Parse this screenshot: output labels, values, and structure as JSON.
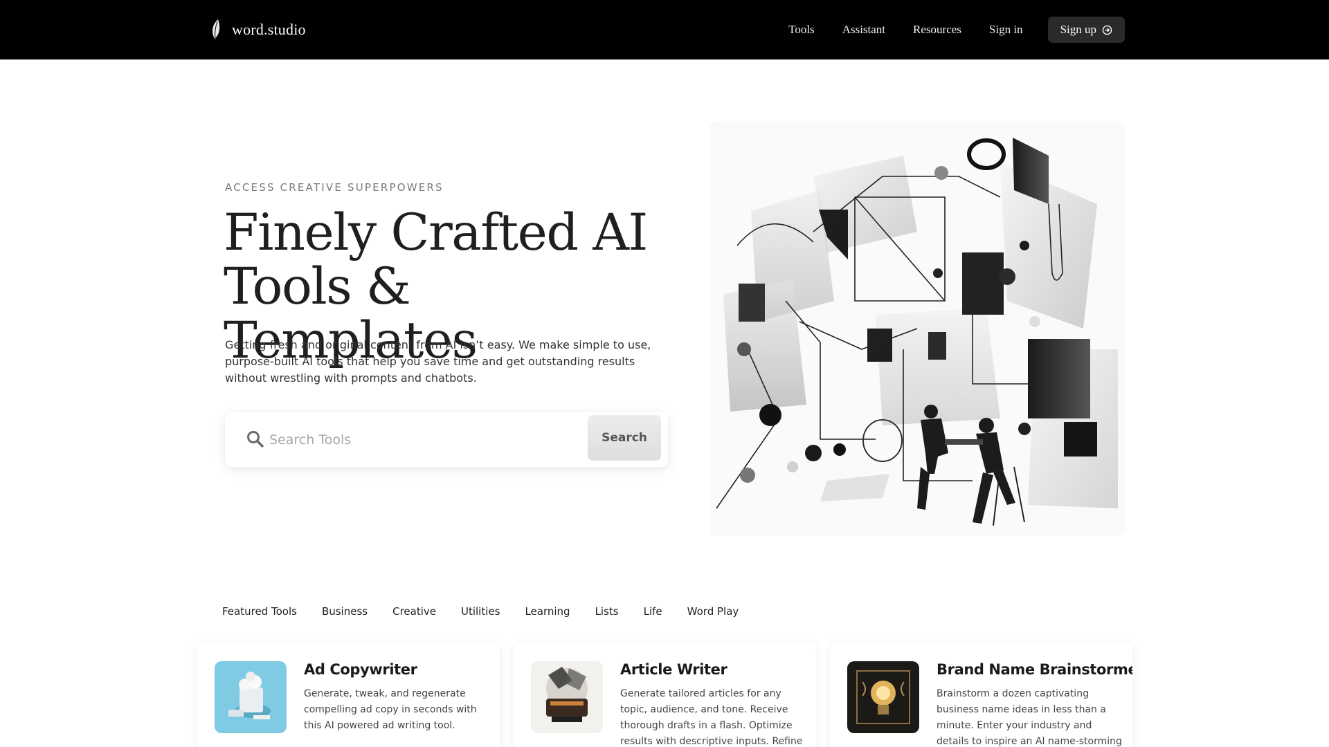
{
  "header": {
    "brand": "word.studio",
    "nav": [
      "Tools",
      "Assistant",
      "Resources",
      "Sign in"
    ],
    "signup_label": "Sign up"
  },
  "hero": {
    "eyebrow": "ACCESS CREATIVE SUPERPOWERS",
    "headline": "Finely Crafted AI Tools & Templates",
    "description": "Getting fresh and original content from AI isn’t easy. We make  simple to use, purpose-built AI tools that help you save time and get outstanding results without wrestling with prompts and chatbots.",
    "search_placeholder": "Search Tools",
    "search_button": "Search"
  },
  "tabs": [
    "Featured Tools",
    "Business",
    "Creative",
    "Utilities",
    "Learning",
    "Lists",
    "Life",
    "Word Play"
  ],
  "cards": [
    {
      "title": "Ad Copywriter",
      "description": "Generate, tweak, and regenerate compelling ad copy in seconds with this AI powered ad writing tool.",
      "thumb_color": "#7fcbe3"
    },
    {
      "title": "Article Writer",
      "description": "Generate tailored articles for any topic, audience, and tone. Receive thorough drafts in a flash. Optimize results with descriptive inputs. Refine and",
      "thumb_color": "#f3f1ee"
    },
    {
      "title": "Brand Name Brainstormer",
      "description": "Brainstorm a dozen captivating business name ideas in less than a minute. Enter your industry and details to inspire an AI name-storming",
      "thumb_color": "#1c1a17"
    }
  ]
}
